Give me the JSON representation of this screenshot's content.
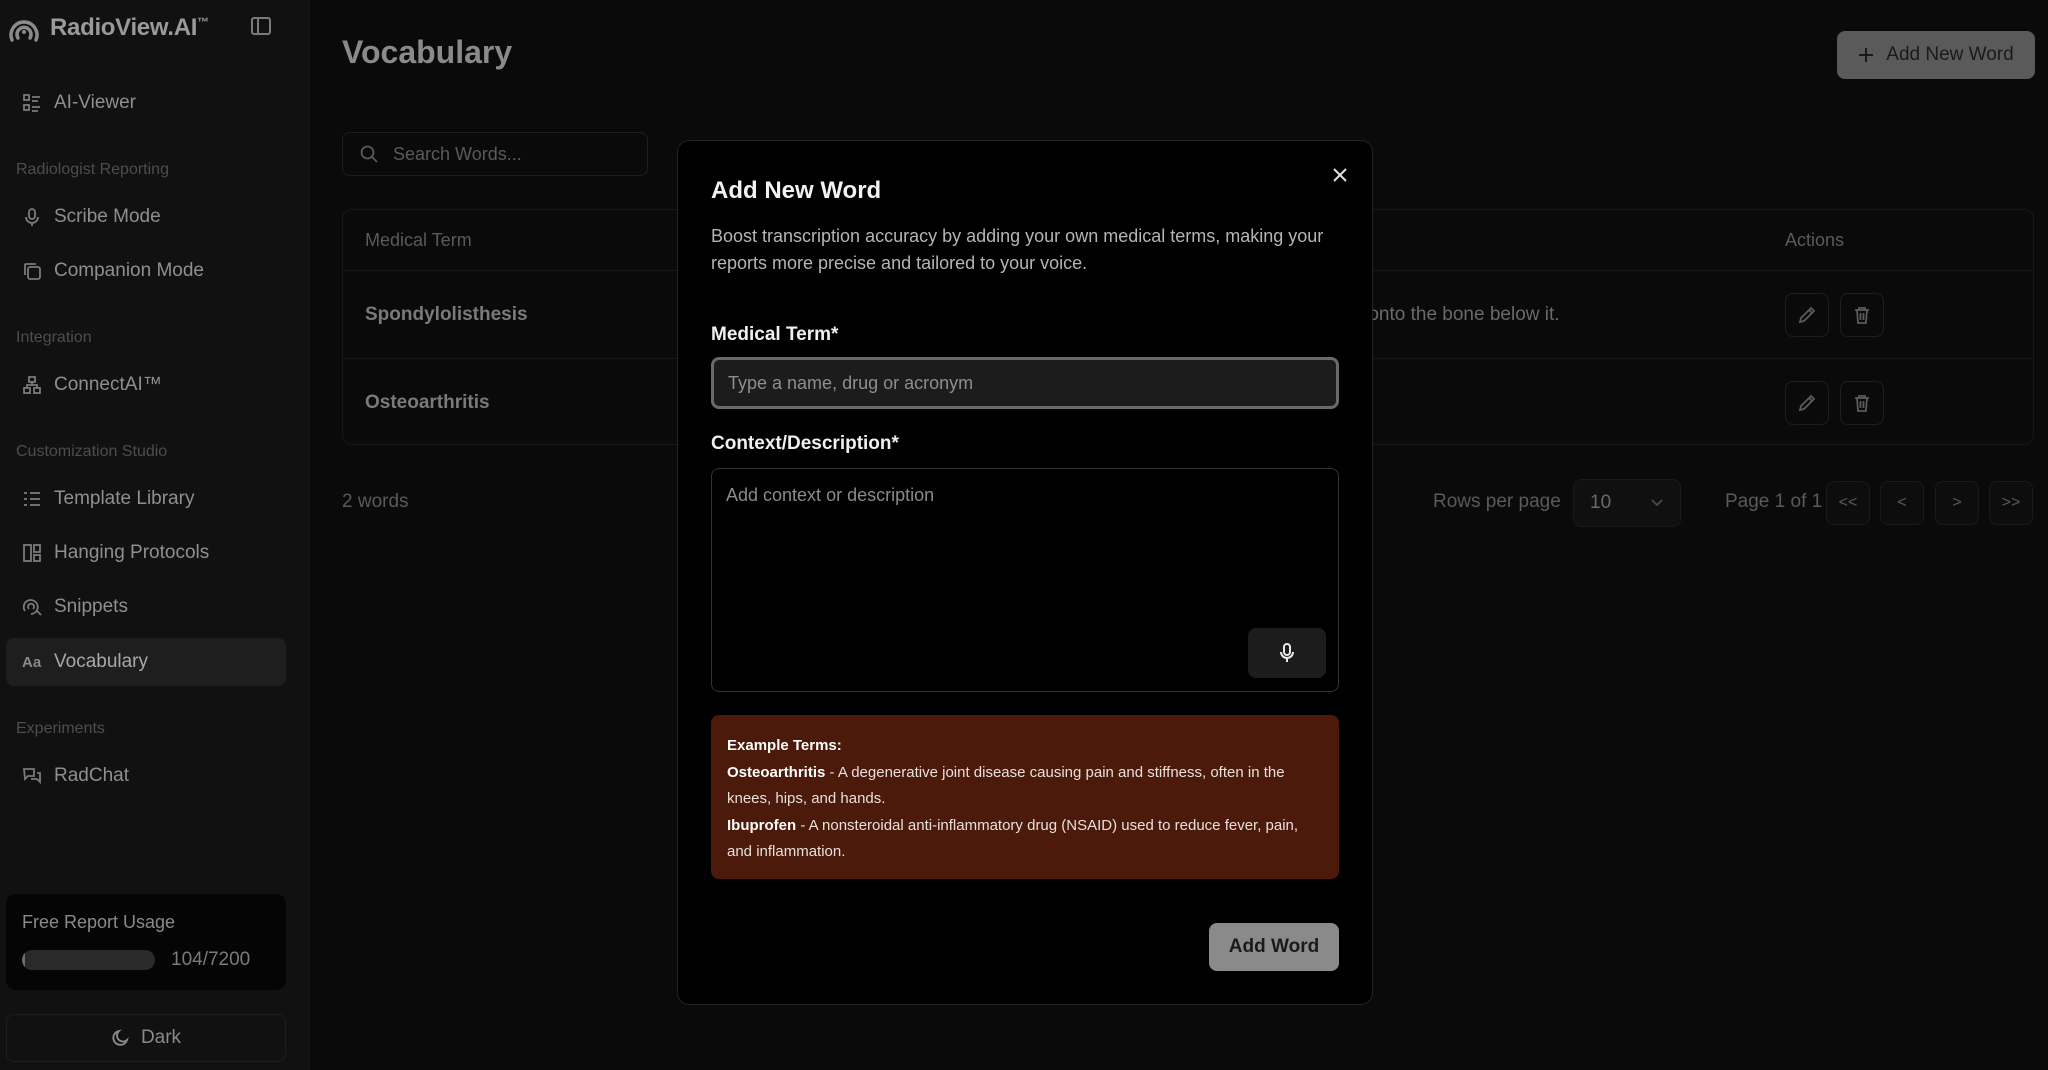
{
  "sidebar": {
    "logo": {
      "text": "RadioView.AI",
      "tm": "™"
    },
    "top_items": [
      {
        "label": "AI-Viewer",
        "icon": "list-icon"
      }
    ],
    "sections": [
      {
        "title": "Radiologist Reporting",
        "items": [
          {
            "label": "Scribe Mode",
            "icon": "mic-icon"
          },
          {
            "label": "Companion Mode",
            "icon": "copy-icon"
          }
        ]
      },
      {
        "title": "Integration",
        "items": [
          {
            "label": "ConnectAI™",
            "icon": "network-icon"
          }
        ]
      },
      {
        "title": "Customization Studio",
        "items": [
          {
            "label": "Template Library",
            "icon": "list-icon"
          },
          {
            "label": "Hanging Protocols",
            "icon": "layout-icon"
          },
          {
            "label": "Snippets",
            "icon": "snippet-icon"
          },
          {
            "label": "Vocabulary",
            "icon": "text-aa-icon",
            "active": true
          }
        ]
      },
      {
        "title": "Experiments",
        "items": [
          {
            "label": "RadChat",
            "icon": "chat-icon"
          }
        ]
      }
    ],
    "usage": {
      "label": "Free Report Usage",
      "count": "104/7200",
      "used": 104,
      "total": 7200
    },
    "theme": {
      "label": "Dark"
    }
  },
  "main": {
    "title": "Vocabulary",
    "add_button": "Add New Word",
    "search_placeholder": "Search Words...",
    "table": {
      "headers": {
        "term": "Medical Term",
        "actions": "Actions"
      },
      "rows": [
        {
          "term": "Spondylolisthesis",
          "description": "ce onto the bone below it."
        },
        {
          "term": "Osteoarthritis",
          "description": ""
        }
      ]
    },
    "footer": {
      "count": "2 words",
      "rows_per_page_label": "Rows per page",
      "rows_per_page": "10",
      "page_info": "Page 1 of 1",
      "first": "<<",
      "prev": "<",
      "next": ">",
      "last": ">>"
    }
  },
  "modal": {
    "title": "Add New Word",
    "description": "Boost transcription accuracy by adding your own medical terms, making your reports more precise and tailored to your voice.",
    "term_label": "Medical Term*",
    "term_placeholder": "Type a name, drug or acronym",
    "context_label": "Context/Description*",
    "context_placeholder": "Add context or description",
    "examples": {
      "heading": "Example Terms:",
      "items": [
        {
          "term": "Osteoarthritis",
          "text": " - A degenerative joint disease causing pain and stiffness, often in the knees, hips, and hands."
        },
        {
          "term": "Ibuprofen",
          "text": " - A nonsteroidal anti-inflammatory drug (NSAID) used to reduce fever, pain, and inflammation."
        }
      ]
    },
    "submit": "Add Word"
  },
  "colors": {
    "examples_bg": "#4b1a0a",
    "modal_bg": "#000000",
    "page_bg": "#0a0a0a"
  }
}
